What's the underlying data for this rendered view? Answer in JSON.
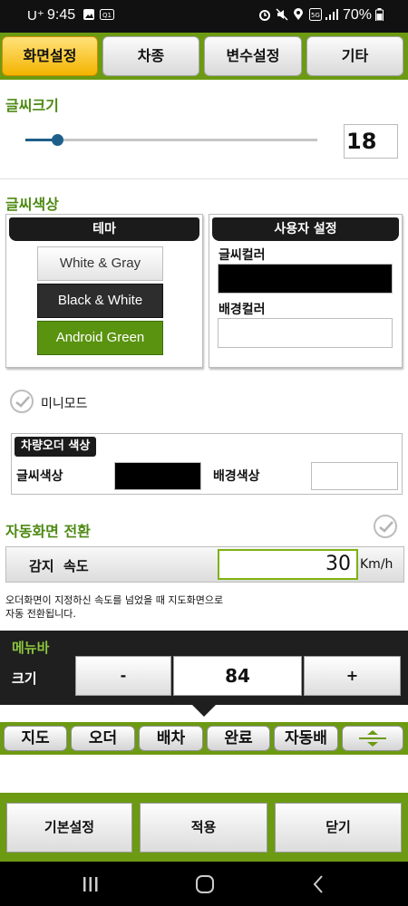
{
  "status_bar": {
    "carrier": "U⁺",
    "time": "9:45",
    "network": "5G",
    "battery": "70%"
  },
  "tabs": [
    {
      "label": "화면설정",
      "active": true
    },
    {
      "label": "차종",
      "active": false
    },
    {
      "label": "변수설정",
      "active": false
    },
    {
      "label": "기타",
      "active": false
    }
  ],
  "font_size": {
    "title": "글씨크기",
    "value": "18",
    "slider_level": 0.11
  },
  "font_color": {
    "title": "글씨색상",
    "theme": {
      "header": "테마",
      "options": [
        "White & Gray",
        "Black & White",
        "Android Green"
      ]
    },
    "user": {
      "header": "사용자 설정",
      "text_color_label": "글씨컬러",
      "bg_color_label": "배경컬러",
      "text_color": "#000000",
      "bg_color": "#ffffff"
    }
  },
  "mini_mode": {
    "label": "미니모드",
    "checked": true
  },
  "order_color": {
    "header": "차량오더 색상",
    "text_label": "글씨색상",
    "bg_label": "배경색상",
    "text_color": "#000000",
    "bg_color": "#ffffff"
  },
  "auto_switch": {
    "title": "자동화면 전환",
    "checked": true,
    "speed_label": "감지  속도",
    "speed_value": "30",
    "speed_unit": "Km/h",
    "description_line1": "오더화면이 지정하신 속도를 넘었을 때 지도화면으로",
    "description_line2": "자동 전환됩니다."
  },
  "menubar": {
    "title": "메뉴바",
    "size_label": "크기",
    "minus_label": "-",
    "value": "84",
    "plus_label": "+"
  },
  "preview_buttons": [
    "지도",
    "오더",
    "배차",
    "완료",
    "자동배"
  ],
  "bottom_buttons": {
    "default": "기본설정",
    "apply": "적용",
    "close": "닫기"
  },
  "colors": {
    "accent_green": "#6c9a12",
    "title_green": "#4d8a13",
    "active_tab": "#f4b400"
  }
}
